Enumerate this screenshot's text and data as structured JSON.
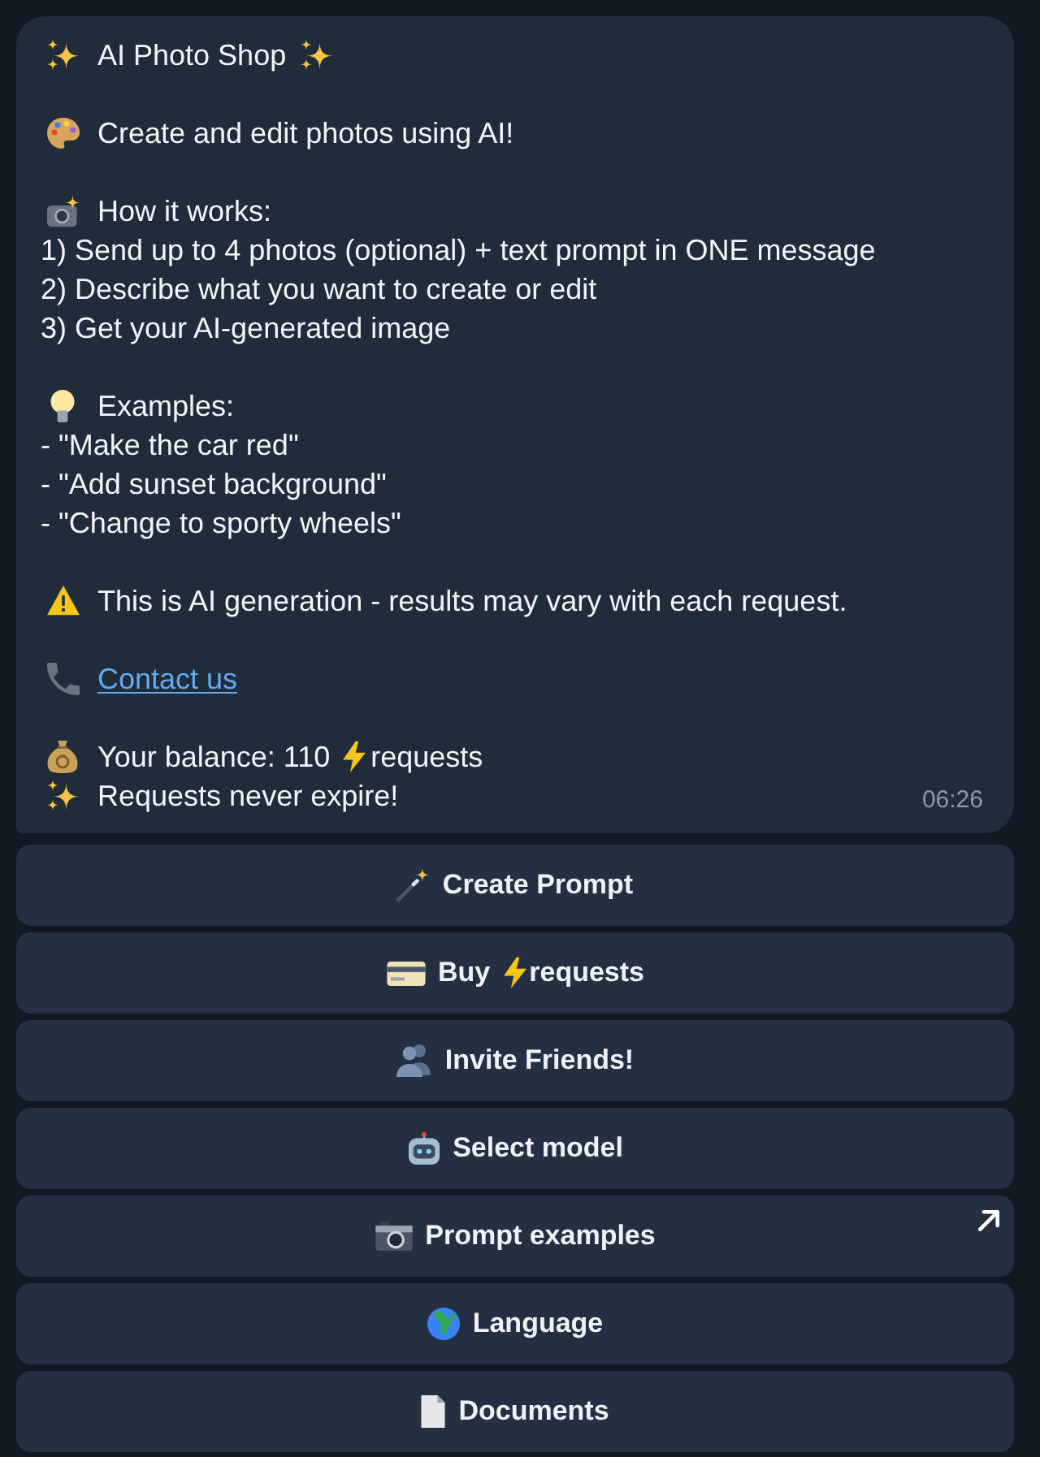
{
  "message": {
    "paragraphs": [
      [
        {
          "kind": "text",
          "parts": [
            "AI Photo Shop"
          ]
        }
      ],
      [
        {
          "kind": "text",
          "parts": [
            "Create and edit photos using AI!"
          ]
        }
      ],
      [
        {
          "kind": "text",
          "parts": [
            "How it works:"
          ]
        },
        {
          "kind": "text",
          "parts": [
            "1) Send up to 4 photos (optional) + text prompt in ONE message"
          ]
        },
        {
          "kind": "text",
          "parts": [
            "2) Describe what you want to create or edit"
          ]
        },
        {
          "kind": "text",
          "parts": [
            "3) Get your AI-generated image"
          ]
        }
      ],
      [
        {
          "kind": "text",
          "parts": [
            "Examples:"
          ]
        },
        {
          "kind": "text",
          "parts": [
            "- \"Make the car red\""
          ]
        },
        {
          "kind": "text",
          "parts": [
            "- \"Add sunset background\""
          ]
        },
        {
          "kind": "text",
          "parts": [
            "- \"Change to sporty wheels\""
          ]
        }
      ],
      [
        {
          "kind": "text",
          "parts": [
            "This is AI generation - results may vary with each request."
          ]
        }
      ],
      [
        {
          "kind": "link",
          "parts": [
            "Contact us"
          ]
        }
      ],
      [
        {
          "kind": "text",
          "parts": [
            "Your balance: 110",
            "requests"
          ]
        },
        {
          "kind": "text",
          "parts": [
            "Requests never expire!"
          ]
        }
      ]
    ],
    "time": "06:26"
  },
  "buttons": [
    {
      "kind": "action",
      "parts": [
        "Create Prompt"
      ]
    },
    {
      "kind": "action",
      "parts": [
        "Buy",
        "requests"
      ]
    },
    {
      "kind": "action",
      "parts": [
        "Invite Friends!"
      ]
    },
    {
      "kind": "action",
      "parts": [
        "Select model"
      ]
    },
    {
      "kind": "link",
      "parts": [
        "Prompt examples"
      ]
    },
    {
      "kind": "action",
      "parts": [
        "Language"
      ]
    },
    {
      "kind": "action",
      "parts": [
        "Documents"
      ]
    }
  ]
}
